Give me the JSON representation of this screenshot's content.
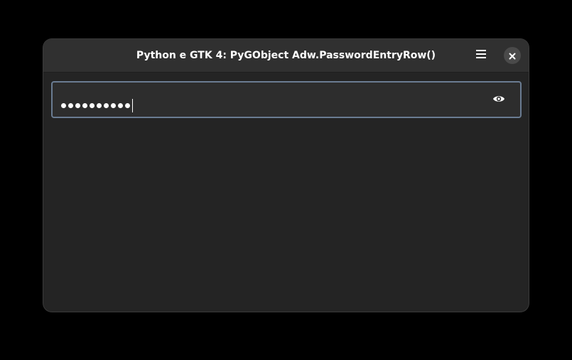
{
  "window": {
    "title": "Python e GTK 4: PyGObject Adw.PasswordEntryRow()"
  },
  "headerbar": {
    "menu_icon": "hamburger-menu-icon",
    "close_icon": "close-icon"
  },
  "password_entry": {
    "masked_length": 10,
    "peek_icon": "eye-icon",
    "focused": true
  },
  "colors": {
    "window_bg": "#242424",
    "headerbar_bg": "#303030",
    "entry_bg": "#2d2d2d",
    "focus_border": "#6a7c92",
    "text": "#ffffff"
  }
}
